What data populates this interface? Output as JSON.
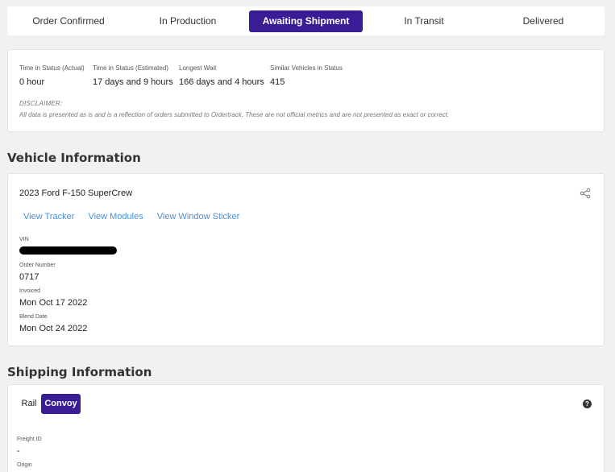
{
  "tabs": [
    {
      "label": "Order Confirmed"
    },
    {
      "label": "In Production"
    },
    {
      "label": "Awaiting Shipment"
    },
    {
      "label": "In Transit"
    },
    {
      "label": "Delivered"
    }
  ],
  "active_tab": "Awaiting Shipment",
  "metrics": {
    "items": [
      {
        "label": "Time in Status (Actual)",
        "value": "0 hour"
      },
      {
        "label": "Time in Status (Estimated)",
        "value": "17 days and 9 hours"
      },
      {
        "label": "Longest Wait",
        "value": "166 days and 4 hours"
      },
      {
        "label": "Similar Vehicles in Status",
        "value": "415"
      }
    ],
    "disclaimer_title": "DISCLAIMER:",
    "disclaimer_text": "All data is presented as is and is a reflection of orders submitted to Ordertrack. These are not official metrics and are not presented as exact or correct."
  },
  "vehicle": {
    "section_title": "Vehicle Information",
    "name": "2023 Ford F-150 SuperCrew",
    "links": [
      "View Tracker",
      "View Modules",
      "View Window Sticker"
    ],
    "fields": [
      {
        "label": "VIN",
        "value": ""
      },
      {
        "label": "Order Number",
        "value": "0717"
      },
      {
        "label": "Invoiced",
        "value": "Mon Oct 17 2022"
      },
      {
        "label": "Blend Date",
        "value": "Mon Oct 24 2022"
      }
    ]
  },
  "shipping": {
    "section_title": "Shipping Information",
    "options": [
      "Rail",
      "Convoy"
    ],
    "active_option": "Convoy",
    "help_glyph": "?",
    "fields": [
      {
        "label": "Freight ID",
        "value": "-"
      },
      {
        "label": "Origin",
        "value": ""
      }
    ]
  },
  "colors": {
    "accent": "#3a1d95",
    "link": "#4a90d9"
  }
}
